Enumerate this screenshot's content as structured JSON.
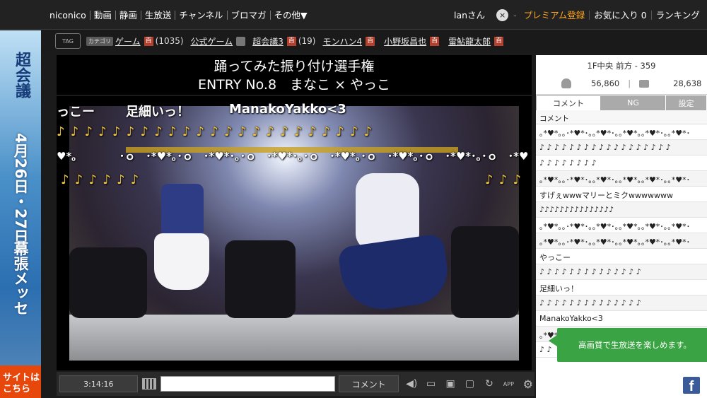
{
  "topbar": {
    "nav": [
      "niconico",
      "動画",
      "静画",
      "生放送",
      "チャンネル",
      "ブロマガ",
      "その他▼"
    ],
    "user": "lanさん",
    "close_glyph": "×",
    "premium": "プレミアム登録",
    "favorites": "お気に入り 0",
    "ranking": "ランキング"
  },
  "tags": {
    "icon_label": "TAG",
    "category_badge": "カテゴリ",
    "hyaku_glyph": "百",
    "items": [
      {
        "label": "ゲーム",
        "count": "(1035)"
      },
      {
        "label": "公式ゲーム"
      },
      {
        "label": "超会議3",
        "count": "(19)"
      },
      {
        "label": "モンハン4"
      },
      {
        "label": "小野坂昌也"
      },
      {
        "label": "雷鮎龍太郎"
      }
    ]
  },
  "ad": {
    "top": "超会議",
    "date": "4月26日・27日",
    "venue": "幕張メッセ",
    "bottom": "サイトはこちら"
  },
  "player": {
    "title_line1": "踊ってみた振り付け選手権",
    "title_line2": "ENTRY No.8　まなこ × やっこ",
    "overlay": {
      "c1": "っこー",
      "c2": "足細いっ！",
      "c3": "ManakoYakko<3",
      "notes_row1": "♪ ♪ ♪ ♪ ♪ ♪ ♪ ♪ ♪ ♪ ♪ ♪ ♪ ♪ ♪ ♪ ♪ ♪ ♪ ♪ ♪ ♪ ♪",
      "hearts_row": "♥*｡　　　　･ｏ　･*♥*｡･ｏ　･*♥*･｡･ｏ　･*♥*･｡･ｏ　･*♥*｡･ｏ　･*♥*｡･ｏ　･*♥*･｡･ｏ　･*♥",
      "notes_row2": "♪ ♪ ♪ ♪ ♪ ♪",
      "notes_row3": "♪ ♪ ♪"
    }
  },
  "controls": {
    "time": "3:14:16",
    "comment_button": "コメント",
    "app_label": "APP"
  },
  "panel": {
    "seat": "1F中央 前方 - 359",
    "viewers": "56,860",
    "comments": "28,638",
    "tabs": [
      "コメント",
      "NG",
      "設定"
    ],
    "list_header": "コメント",
    "rows": [
      "｡*♥*｡｡･*♥*･｡｡*♥*･｡｡*♥*｡｡*♥*･｡｡*♥*･",
      "♪ ♪ ♪ ♪ ♪ ♪ ♪ ♪ ♪ ♪ ♪ ♪ ♪ ♪ ♪ ♪ ♪ ♪",
      "♪ ♪ ♪ ♪ ♪ ♪ ♪ ♪",
      "｡*♥*｡｡･*♥*･｡｡*♥*･｡｡*♥*｡｡*♥*･｡｡*♥*･",
      "すげぇwwwマリーとミクwwwwwww",
      "♪♪♪♪♪♪♪♪♪♪♪♪♪♪♪",
      "｡*♥*｡｡･*♥*･｡｡*♥*･｡｡*♥*｡｡*♥*･｡｡*♥*･",
      "｡*♥*｡｡･*♥*･｡｡*♥*･｡｡*♥*｡｡*♥*･｡｡*♥*･",
      "やっこー",
      "♪ ♪ ♪ ♪ ♪ ♪ ♪ ♪ ♪ ♪ ♪ ♪ ♪ ♪",
      "足細いっ！",
      "♪ ♪ ♪ ♪ ♪ ♪ ♪ ♪ ♪ ♪ ♪ ♪ ♪ ♪",
      "ManakoYakko<3",
      "｡*♥*",
      "♪ ♪"
    ],
    "toast": "高画質で生放送を楽しめます。"
  },
  "social": {
    "facebook_glyph": "f"
  }
}
